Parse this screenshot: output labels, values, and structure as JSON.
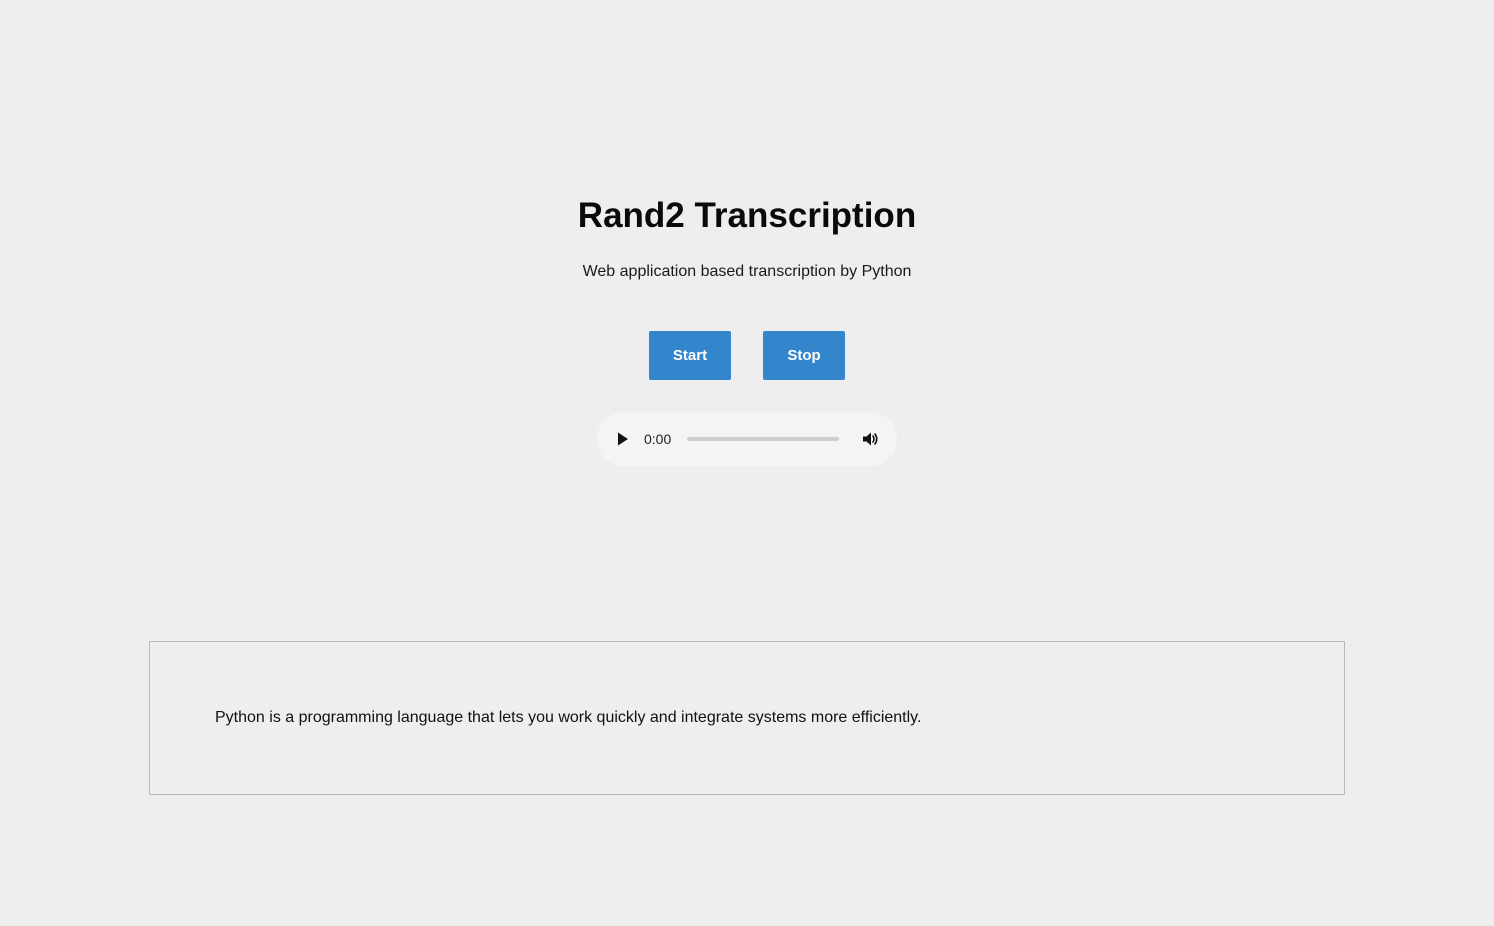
{
  "header": {
    "title": "Rand2 Transcription",
    "subtitle": "Web application based transcription by Python"
  },
  "controls": {
    "start_label": "Start",
    "stop_label": "Stop",
    "accent_color": "#3385cc"
  },
  "audio_player": {
    "current_time": "0:00",
    "play_icon": "play-icon",
    "volume_icon": "volume-icon",
    "progress": 0
  },
  "transcript": {
    "text": "Python is a programming language that lets you work quickly and integrate systems more efficiently."
  }
}
